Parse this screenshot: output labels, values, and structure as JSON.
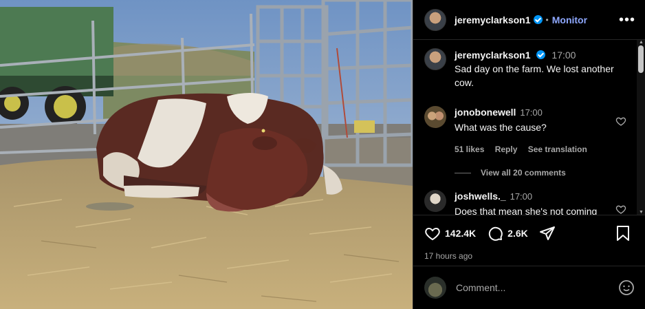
{
  "header": {
    "username": "jeremyclarkson1",
    "separator": "•",
    "follow_label": "Monitor",
    "more_icon": "more-horizontal-icon"
  },
  "caption": {
    "username": "jeremyclarkson1",
    "time": "17:00",
    "text": "Sad day on the farm. We lost another cow."
  },
  "comments": [
    {
      "username": "jonobonewell",
      "time": "17:00",
      "text": "What was the cause?",
      "likes": "51 likes",
      "reply": "Reply",
      "translate": "See translation"
    },
    {
      "username": "joshwells._",
      "time": "17:00",
      "text": "Does that mean she's not coming on then?"
    }
  ],
  "view_all": "View all 20 comments",
  "actions": {
    "likes_count": "142.4K",
    "comments_count": "2.6K",
    "posted_ago": "17 hours ago"
  },
  "composer": {
    "placeholder": "Comment..."
  },
  "colors": {
    "accent": "#0095f6",
    "monitor": "#8ea8ff",
    "background": "#000000"
  }
}
